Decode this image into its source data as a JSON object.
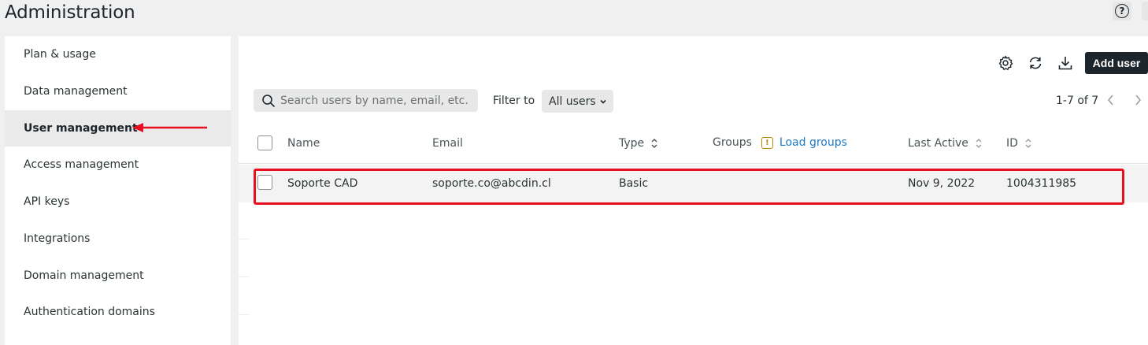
{
  "page": {
    "title": "Administration"
  },
  "sidebar": {
    "items": [
      {
        "label": "Plan & usage"
      },
      {
        "label": "Data management"
      },
      {
        "label": "User management"
      },
      {
        "label": "Access management"
      },
      {
        "label": "API keys"
      },
      {
        "label": "Integrations"
      },
      {
        "label": "Domain management"
      },
      {
        "label": "Authentication domains"
      }
    ],
    "active": "User management"
  },
  "toolbar": {
    "icons": [
      "gear-icon",
      "refresh-icon",
      "download-icon"
    ],
    "add_user_label": "Add user"
  },
  "search": {
    "placeholder": "Search users by name, email, etc.",
    "value": ""
  },
  "filter": {
    "label": "Filter to",
    "selected": "All users"
  },
  "pager": {
    "text": "1-7 of 7"
  },
  "table": {
    "headers": {
      "name": "Name",
      "email": "Email",
      "type": "Type",
      "groups": "Groups",
      "load_groups": "Load groups",
      "warn_glyph": "!",
      "last_active": "Last Active",
      "id": "ID"
    },
    "rows": [
      {
        "name": "Soporte CAD",
        "email": "soporte.co@abcdin.cl",
        "type": "Basic",
        "groups": "",
        "last_active": "Nov 9, 2022",
        "id": "1004311985"
      }
    ]
  },
  "colors": {
    "accent_dark": "#1d252c",
    "link": "#1f7ac4",
    "annotation_red": "#e8101e",
    "warning": "#b58900"
  }
}
